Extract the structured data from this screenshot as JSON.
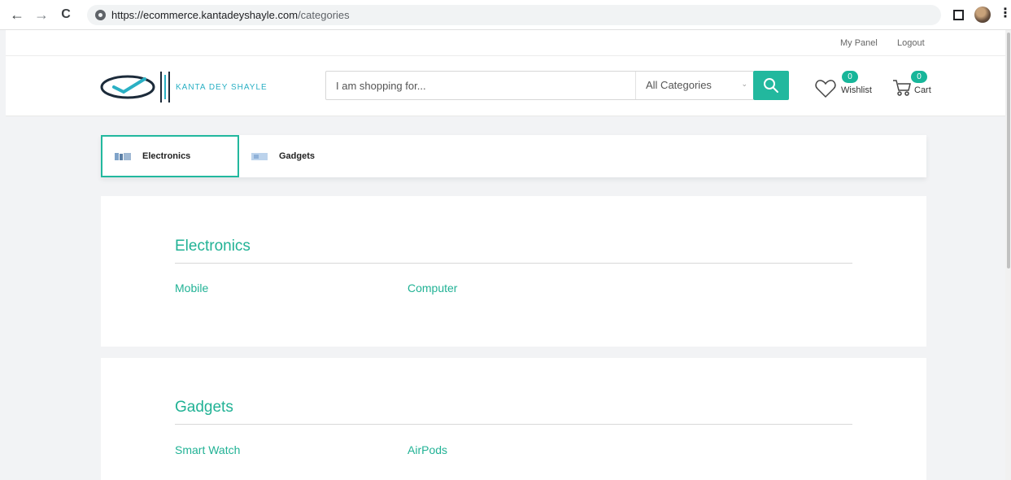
{
  "browser": {
    "url_host": "https://ecommerce.kantadeyshayle.com",
    "url_path": "/categories",
    "back_label": "←",
    "forward_label": "→",
    "reload_label": "C",
    "menu_label": "⋮"
  },
  "top_links": {
    "panel": "My Panel",
    "logout": "Logout"
  },
  "header": {
    "logo_text": "KANTA DEY SHAYLE",
    "search_placeholder": "I am shopping for...",
    "category_select": "All Categories",
    "wishlist_label": "Wishlist",
    "wishlist_count": "0",
    "cart_label": "Cart",
    "cart_count": "0"
  },
  "tabs": [
    {
      "label": "Electronics",
      "active": true
    },
    {
      "label": "Gadgets",
      "active": false
    }
  ],
  "sections": [
    {
      "title": "Electronics",
      "items": [
        "Mobile",
        "Computer"
      ]
    },
    {
      "title": "Gadgets",
      "items": [
        "Smart Watch",
        "AirPods"
      ]
    }
  ],
  "colors": {
    "accent": "#22b89e",
    "logo": "#2ab0c4"
  }
}
